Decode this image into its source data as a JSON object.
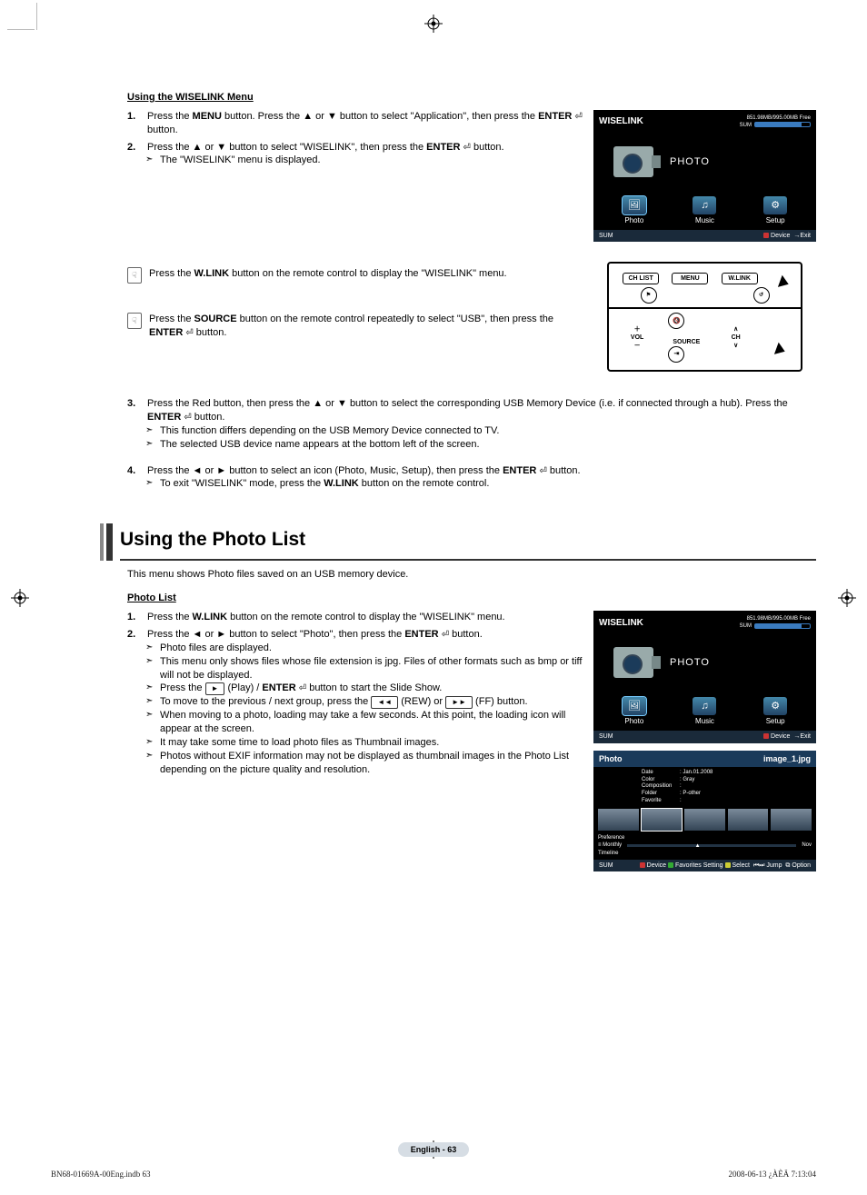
{
  "section1_title": "Using the WISELINK Menu",
  "step1_pre": "Press the ",
  "step1_b1": "MENU",
  "step1_mid": " button. Press the ▲ or ▼ button to select \"Application\", then press the ",
  "step1_b2": "ENTER",
  "step1_end": " button.",
  "step2_pre": "Press the ▲ or ▼ button to select \"WISELINK\", then press the ",
  "step2_b": "ENTER",
  "step2_end": " button.",
  "step2_note": "The \"WISELINK\" menu is displayed.",
  "hand1_pre": "Press the ",
  "hand1_b": "W.LINK",
  "hand1_end": " button on the remote control to display the \"WISELINK\" menu.",
  "hand2_pre": "Press the ",
  "hand2_b": "SOURCE",
  "hand2_end1": " button on the remote control repeatedly to select \"USB\", then press the ",
  "hand2_b2": "ENTER",
  "hand2_end2": " button.",
  "step3_pre": "Press the Red button, then press the ▲ or ▼ button to select the corresponding USB Memory Device (i.e. if connected through a hub). Press the ",
  "step3_b": "ENTER",
  "step3_end": " button.",
  "step3_note1": "This function differs depending on the USB Memory Device connected to TV.",
  "step3_note2": "The selected USB device name appears at the bottom left of the screen.",
  "step4_pre": "Press the ◄ or ► button to select an icon (Photo, Music, Setup), then press the ",
  "step4_b": "ENTER",
  "step4_end": " button.",
  "step4_note_pre": "To exit \"WISELINK\" mode, press the ",
  "step4_note_b": "W.LINK",
  "step4_note_end": " button on the remote control.",
  "h2": "Using the Photo List",
  "intro": "This menu shows Photo files saved on an USB memory device.",
  "section2_title": "Photo List",
  "pl_step1_pre": "Press the ",
  "pl_step1_b": "W.LINK",
  "pl_step1_end": " button on the remote control to display the \"WISELINK\" menu.",
  "pl_step2_pre": "Press the ◄ or ► button to select \"Photo\", then press the ",
  "pl_step2_b": "ENTER",
  "pl_step2_end": " button.",
  "pl_n1": "Photo files are displayed.",
  "pl_n2": "This menu only shows files whose file extension is jpg. Files of other formats such as bmp or tiff will not be displayed.",
  "pl_n3_pre": "Press the ",
  "pl_n3_play": "►",
  "pl_n3_mid": " (Play) / ",
  "pl_n3_b": "ENTER",
  "pl_n3_end": " button to start the Slide Show.",
  "pl_n4_pre": "To move to the previous / next group, press the ",
  "pl_n4_rew": "◄◄",
  "pl_n4_mid": " (REW) or ",
  "pl_n4_ff": "►►",
  "pl_n4_end": " (FF) button.",
  "pl_n5": "When moving to a photo, loading may take a few seconds. At this point, the loading icon will appear at the screen.",
  "pl_n6": "It may take some time to load photo files as Thumbnail images.",
  "pl_n7": "Photos without EXIF information may not be displayed as thumbnail images in the Photo List depending on the picture quality and resolution.",
  "tv": {
    "title": "WISELINK",
    "sum": "SUM",
    "free": "851.98MB/995.00MB Free",
    "photo_big": "PHOTO",
    "tab_photo": "Photo",
    "tab_music": "Music",
    "tab_setup": "Setup",
    "device": "Device",
    "exit": "Exit"
  },
  "remote": {
    "chlist": "CH LIST",
    "menu": "MENU",
    "wlink": "W.LINK",
    "tools": "TOOLS",
    "return": "RETURN",
    "vol": "VOL",
    "source": "SOURCE",
    "ch": "CH"
  },
  "photolist": {
    "hdr": "Photo",
    "file": "image_1.jpg",
    "date_l": "Date",
    "date_v": ": Jan.01.2008",
    "color_l": "Color",
    "color_v": ": Gray",
    "comp_l": "Composition",
    "comp_v": ":",
    "folder_l": "Folder",
    "folder_v": ": P-other",
    "fav_l": "Favorite",
    "fav_v": ":",
    "pref": "Preference",
    "monthly": "Monthly",
    "timeline": "Timeline",
    "nov": "Nov",
    "ftr_device": "Device",
    "ftr_fav": "Favorites Setting",
    "ftr_sel": "Select",
    "ftr_jump": "Jump",
    "ftr_opt": "Option"
  },
  "page_pill": "English - 63",
  "indb": "BN68-01669A-00Eng.indb   63",
  "timestamp": "2008-06-13   ¿ÀÈÄ 7:13:04"
}
